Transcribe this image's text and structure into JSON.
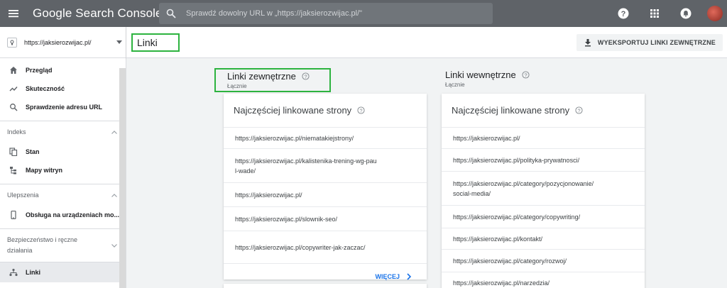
{
  "app": {
    "title": "Google Search Console",
    "search_placeholder": "Sprawdź dowolny URL w „https://jaksierozwijac.pl/\""
  },
  "sidebar": {
    "property": "https://jaksierozwijac.pl/",
    "top_items": [
      {
        "label": "Przegląd",
        "icon": "home-icon"
      },
      {
        "label": "Skuteczność",
        "icon": "trend-icon"
      },
      {
        "label": "Sprawdzenie adresu URL",
        "icon": "search-icon"
      }
    ],
    "sections": [
      {
        "title": "Indeks",
        "items": [
          {
            "label": "Stan",
            "icon": "copy-icon"
          },
          {
            "label": "Mapy witryn",
            "icon": "sitemap-icon"
          }
        ]
      },
      {
        "title": "Ulepszenia",
        "items": [
          {
            "label": "Obsługa na urządzeniach mo...",
            "icon": "phone-icon"
          }
        ]
      },
      {
        "title": "Bezpieczeństwo i ręczne działania",
        "items": []
      }
    ],
    "active_item": {
      "label": "Linki",
      "icon": "links-icon"
    }
  },
  "header": {
    "title": "Linki",
    "export_label": "WYEKSPORTUJ LINKI ZEWNĘTRZNE"
  },
  "external": {
    "title": "Linki zewnętrzne",
    "subtitle": "Łącznie",
    "card_title": "Najczęściej linkowane strony",
    "rows": [
      "https://jaksierozwijac.pl/niematakiejstrony/",
      "https://jaksierozwijac.pl/kalistenika-trening-wg-paul-wade/",
      "https://jaksierozwijac.pl/",
      "https://jaksierozwijac.pl/slownik-seo/",
      "https://jaksierozwijac.pl/copywriter-jak-zaczac/"
    ],
    "more_label": "WIĘCEJ"
  },
  "internal": {
    "title": "Linki wewnętrzne",
    "subtitle": "Łącznie",
    "card_title": "Najczęściej linkowane strony",
    "rows": [
      "https://jaksierozwijac.pl/",
      "https://jaksierozwijac.pl/polityka-prywatnosci/",
      "https://jaksierozwijac.pl/category/pozycjonowanie/social-media/",
      "https://jaksierozwijac.pl/category/copywriting/",
      "https://jaksierozwijac.pl/kontakt/",
      "https://jaksierozwijac.pl/category/rozwoj/",
      "https://jaksierozwijac.pl/narzedzia/"
    ]
  },
  "colors": {
    "appbar": "#5f6368",
    "highlight": "#2db33f",
    "accent": "#1a73e8"
  }
}
